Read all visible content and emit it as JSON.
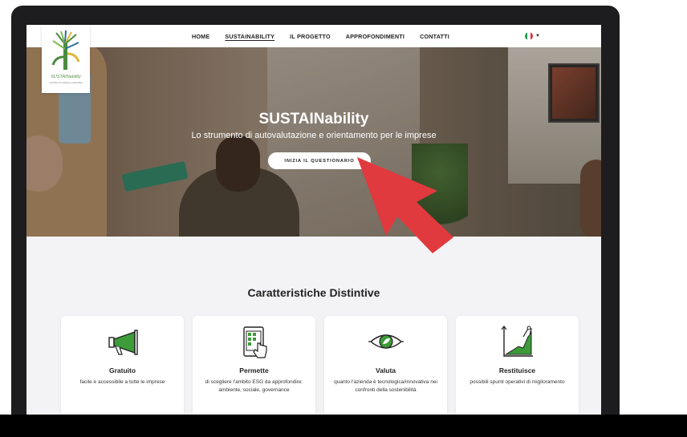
{
  "logo": {
    "name": "SUSTAINability",
    "tagline": "L'ambito di sviluppo sostenibile"
  },
  "nav": {
    "links": [
      "HOME",
      "SUSTAINABILITY",
      "IL PROGETTO",
      "APPROFONDIMENTI",
      "CONTATTI"
    ],
    "active": "SUSTAINABILITY",
    "language_flag": "italy-flag-icon"
  },
  "hero": {
    "title": "SUSTAINability",
    "subtitle": "Lo strumento di autovalutazione e orientamento per le imprese",
    "cta_label": "INIZIA IL QUESTIONARIO"
  },
  "features": {
    "title": "Caratteristiche Distintive",
    "cards": [
      {
        "icon": "megaphone-icon",
        "title": "Gratuito",
        "desc": "facile e accessibile a tutte le imprese"
      },
      {
        "icon": "tablet-touch-icon",
        "title": "Permette",
        "desc": "di scegliere l'ambito ESG da approfondire: ambiente, sociale, governance"
      },
      {
        "icon": "eye-leaf-icon",
        "title": "Valuta",
        "desc": "quanto l'azienda è tecnologica/innovativa nei confronti della sostenibilità"
      },
      {
        "icon": "growth-chart-icon",
        "title": "Restituisce",
        "desc": "possibili spunti operativi di miglioramento"
      }
    ]
  },
  "colors": {
    "accent_green": "#3d9b3a",
    "arrow_red": "#e03a3e",
    "frame": "#1d1d1f"
  }
}
